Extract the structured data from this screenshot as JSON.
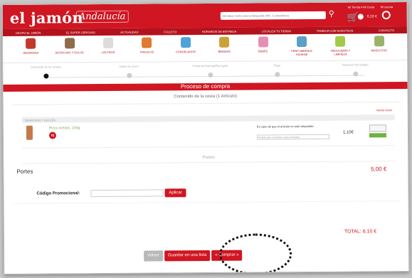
{
  "header": {
    "logo": "el jamón",
    "logo_sub": "Andalucía",
    "search_placeholder": "Introduce texto para la búsqueda (mín. 3 caracteres)",
    "toplinks": "Mi Tienda ▾  Mi Cesta",
    "cart_total": "6,10 €",
    "account_label": "Mi cuenta"
  },
  "topnav": [
    "GRUPO EL JAMÓN",
    "EL SUPER CERCANO",
    "ACTUALIDAD",
    "FOLLETO",
    "HORARIOS DE ENTREGA",
    "LOCALIZA TU TIENDA",
    "TRABAJA CON NOSOTROS",
    "CONTACTO"
  ],
  "categories": [
    {
      "label": "DESPENSA",
      "color": "#c0392b"
    },
    {
      "label": "DESAYUNO Y DULCE",
      "color": "#8e6b4a"
    },
    {
      "label": "LÁCTEOS",
      "color": "#dcdcdc"
    },
    {
      "label": "FRESCOS",
      "color": "#e07a2e"
    },
    {
      "label": "CONGELADOS",
      "color": "#4fa3d8"
    },
    {
      "label": "BEBIDAS",
      "color": "#c9a23a"
    },
    {
      "label": "BEBÉS",
      "color": "#e58fb5"
    },
    {
      "label": "PERFUMERÍA E HIGIENE",
      "color": "#5aa0c8"
    },
    {
      "label": "DROGUERÍA Y LIMPIEZA",
      "color": "#a3c94a"
    },
    {
      "label": "MASCOTAS",
      "color": "#9ab36a"
    }
  ],
  "steps": [
    "Contenido de la compra",
    "Datos de envío",
    "Fecha de Entrega/Recogida",
    "Pago",
    "Resumen del pedido"
  ],
  "bar_title": "Proceso de compra",
  "subtitle": "Contenido de la cesta (1 Artículo)",
  "clear_link": "Vaciar cesta",
  "section_title": "DESAYUNO Y DULCES",
  "product": {
    "name": "Picos ochitos, 225g",
    "badge": "ej",
    "note": "En caso de que el artículo no esté disponible:",
    "note_placeholder": "Pedirle que me llamen para consultar",
    "price": "1,10€"
  },
  "portes_header": "Portes",
  "portes_label": "Portes",
  "portes_value": "5,00 €",
  "promo": {
    "label": "Código Promocional:",
    "button": "Aplicar"
  },
  "total": "TOTAL:  6,10 €",
  "actions": {
    "back": "Volver",
    "save": "Guardar en una lista",
    "buy": "« Comprar »"
  },
  "colors": {
    "brand_red": "#d01622",
    "nav_red": "#b3121c",
    "accent_green": "#6db33f"
  }
}
